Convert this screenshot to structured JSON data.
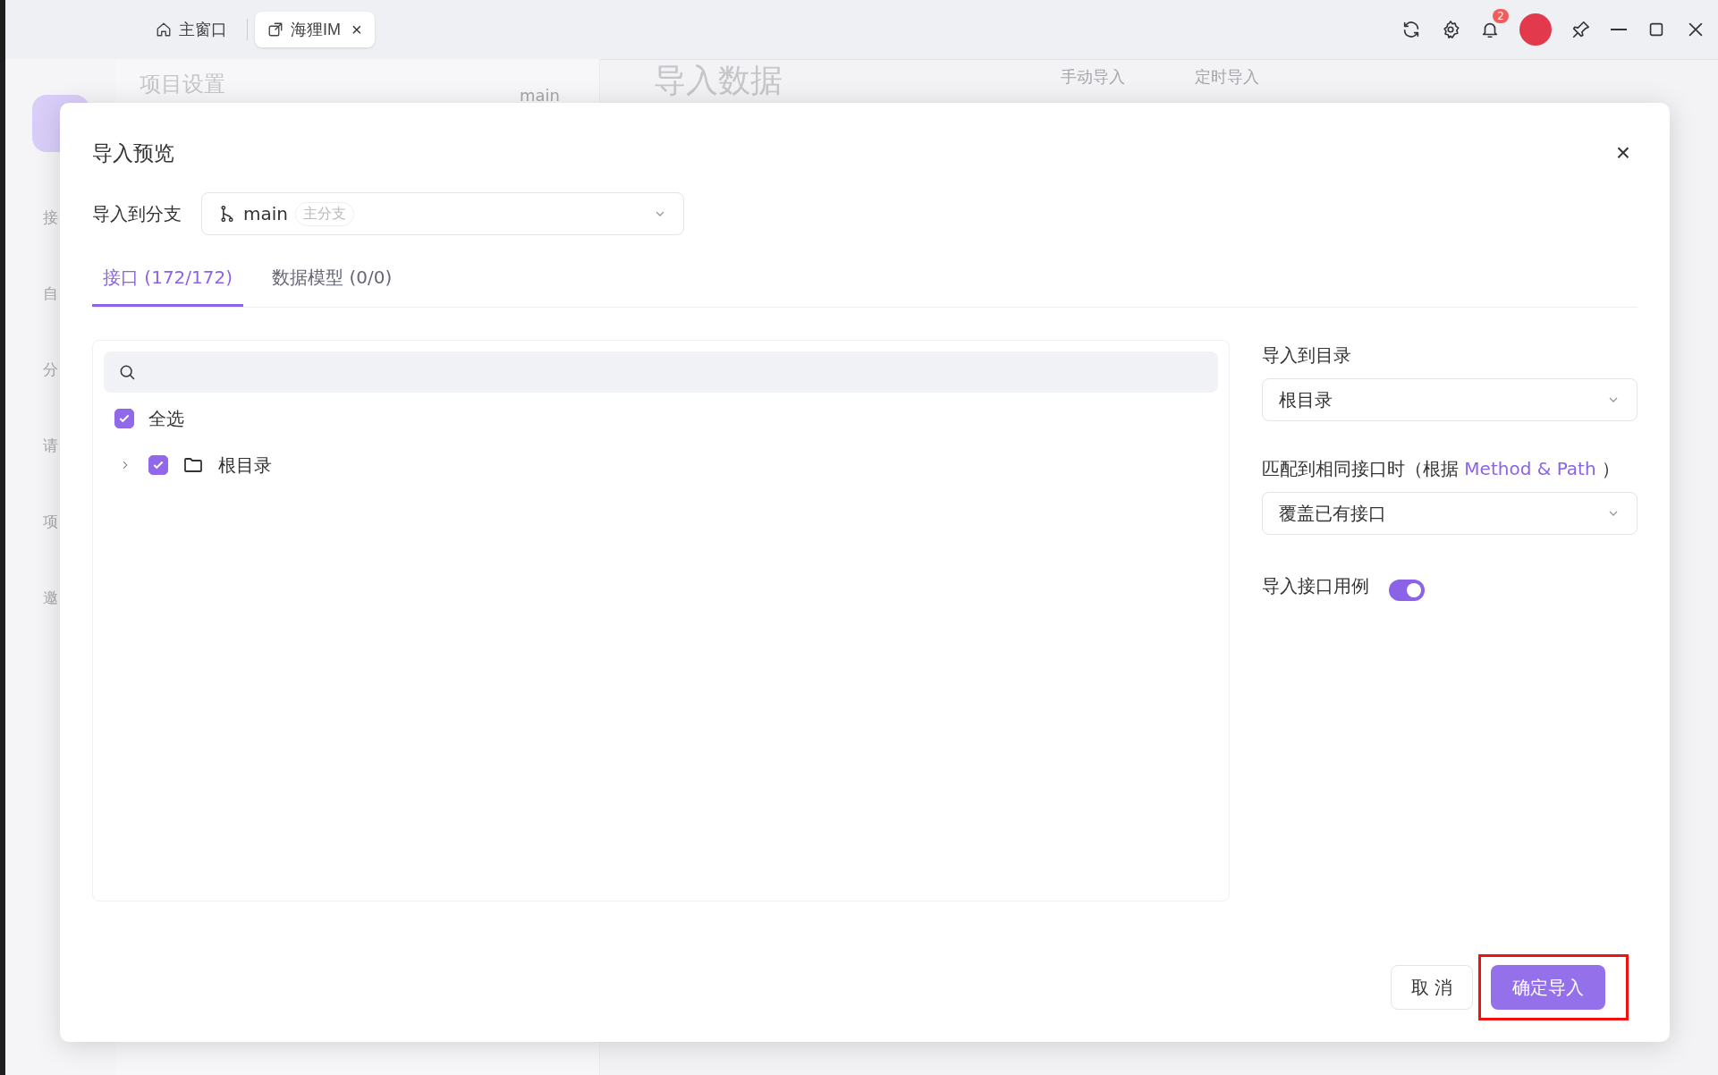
{
  "titlebar": {
    "tabs": [
      {
        "label": "主窗口",
        "selected": false
      },
      {
        "label": "海狸IM",
        "selected": true,
        "close": "×"
      }
    ],
    "notification_count": "2"
  },
  "background": {
    "sidebar": [
      "接",
      "自",
      "分",
      "请",
      "项",
      "邀"
    ],
    "panel_title": "项目设置",
    "branch": "main",
    "page_title": "导入数据",
    "actions": [
      "手动导入",
      "定时导入"
    ]
  },
  "dialog": {
    "title": "导入预览",
    "close_glyph": "×",
    "branch_field": {
      "label": "导入到分支",
      "value": "main",
      "badge": "主分支"
    },
    "tabs": [
      {
        "label": "接口 (172/172)",
        "selected": true
      },
      {
        "label": "数据模型 (0/0)",
        "selected": false
      }
    ],
    "tree": {
      "select_all": {
        "label": "全选",
        "checked": true
      },
      "items": [
        {
          "label": "根目录",
          "checked": true,
          "expanded": false
        }
      ]
    },
    "target_dir": {
      "label": "导入到目录",
      "value": "根目录"
    },
    "match": {
      "label": "匹配到相同接口时（根据 ",
      "link": "Method & Path",
      "label_end": " ）",
      "value": "覆盖已有接口"
    },
    "import_cases": {
      "label": "导入接口用例",
      "on": true
    },
    "buttons": [
      {
        "label": "取 消",
        "kind": "secondary",
        "highlighted": false
      },
      {
        "label": "确定导入",
        "kind": "primary",
        "highlighted": true
      }
    ]
  }
}
